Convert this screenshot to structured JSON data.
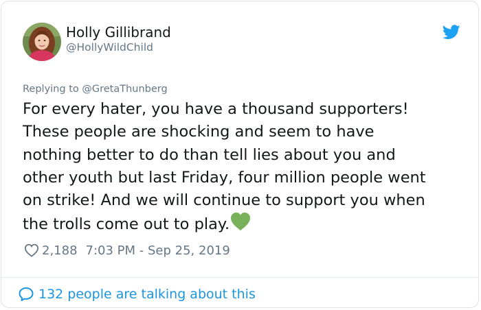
{
  "author": {
    "display_name": "Holly Gillibrand",
    "handle": "@HollyWildChild",
    "avatar_icon": "profile-photo"
  },
  "reply": {
    "text": "Replying to @GretaThunberg"
  },
  "tweet": {
    "text": "For every hater, you have a thousand supporters!\nThese people are shocking and seem to have\nnothing better to do than tell lies about you and\nother youth but last Friday, four million people went\non strike! And we will continue to support you when\nthe trolls come out to play.",
    "emoji": "green-heart"
  },
  "meta": {
    "like_count": "2,188",
    "timestamp": "7:03 PM - Sep 25, 2019"
  },
  "footer": {
    "talking_text": "132 people are talking about this"
  },
  "colors": {
    "twitter_blue": "#1da1f2",
    "link_blue": "#1b95e0",
    "text_dark": "#14171a",
    "text_gray": "#657786",
    "heart_green": "#78b159"
  }
}
